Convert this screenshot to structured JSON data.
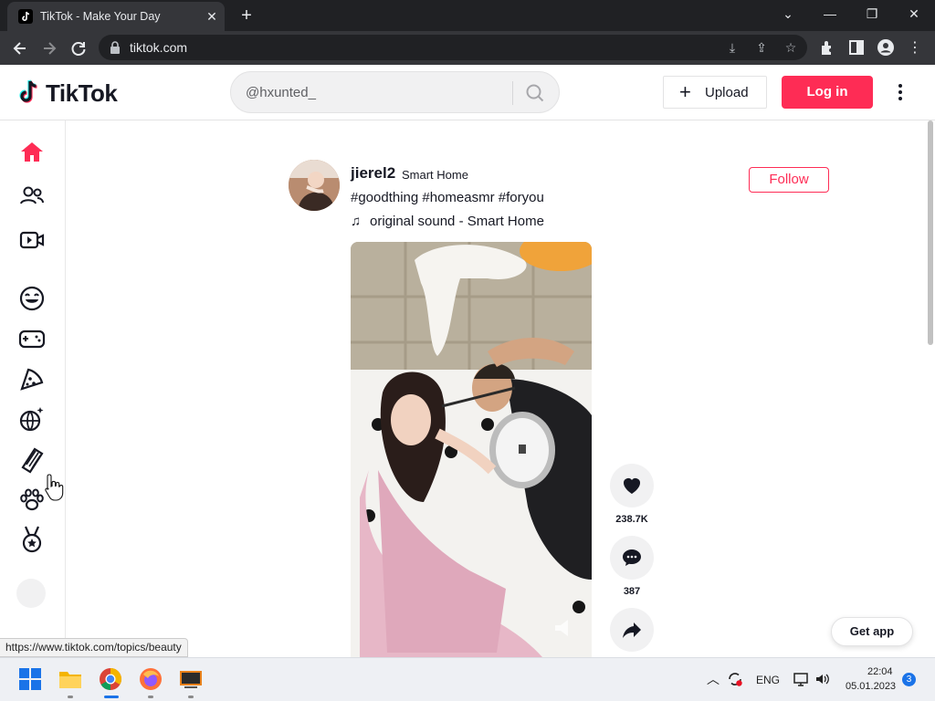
{
  "browser": {
    "tab_title": "TikTok - Make Your Day",
    "url": "tiktok.com",
    "status_url": "https://www.tiktok.com/topics/beauty"
  },
  "header": {
    "logo_text": "TikTok",
    "search_value": "@hxunted_",
    "upload_label": "Upload",
    "login_label": "Log in"
  },
  "sidebar": {
    "items": [
      "home-icon",
      "following-icon",
      "live-icon",
      "comedy-icon",
      "gaming-icon",
      "food-icon",
      "dance-icon",
      "beauty-icon",
      "animals-icon",
      "sports-icon"
    ]
  },
  "post": {
    "username": "jierel2",
    "nickname": "Smart Home",
    "caption": "#goodthing #homeasmr #foryou",
    "music": "original sound - Smart Home",
    "follow_label": "Follow",
    "likes": "238.7K",
    "comments": "387"
  },
  "floating": {
    "get_app": "Get app"
  },
  "taskbar": {
    "lang": "ENG",
    "time": "22:04",
    "date": "05.01.2023",
    "notifications": "3"
  },
  "colors": {
    "brand": "#fe2c55",
    "text": "#161823",
    "chrome_dark": "#202124"
  }
}
